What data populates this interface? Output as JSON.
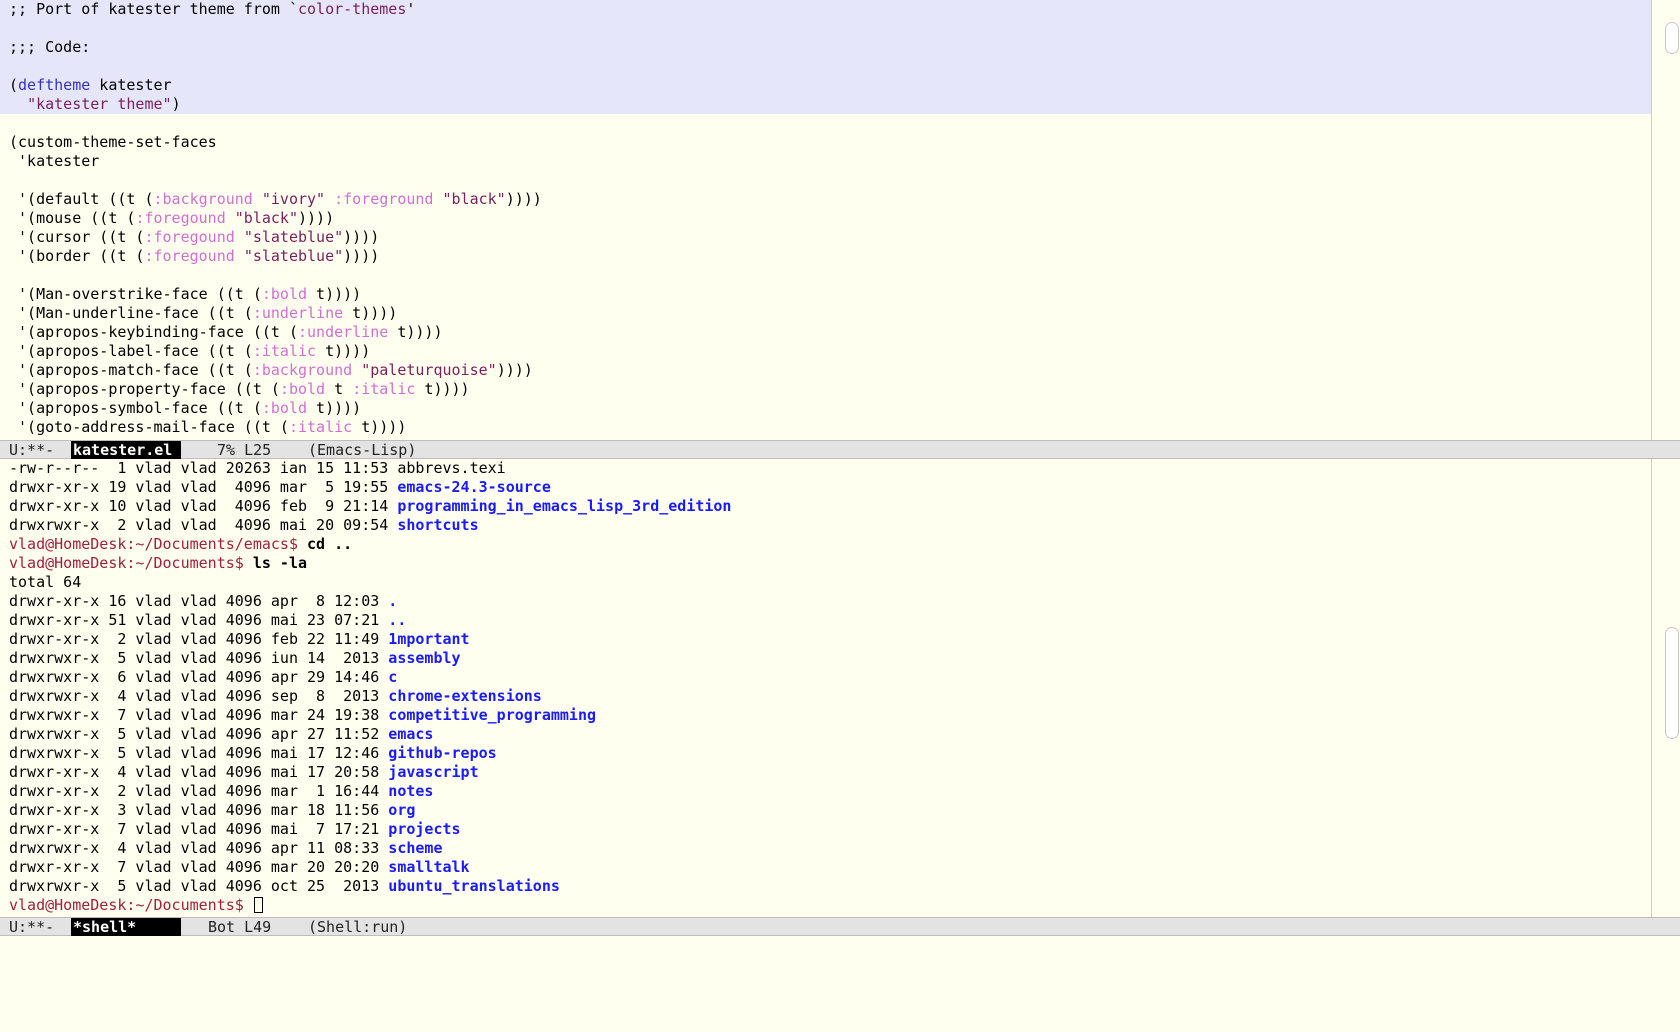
{
  "editor": {
    "lines": [
      {
        "hl": true,
        "segs": [
          {
            "t": ";; Port of katester theme from `"
          },
          {
            "t": "color-themes",
            "c": "str"
          },
          {
            "t": "'"
          }
        ]
      },
      {
        "hl": true,
        "segs": [
          {
            "t": ""
          }
        ]
      },
      {
        "hl": true,
        "segs": [
          {
            "t": ";;; Code:"
          }
        ]
      },
      {
        "hl": true,
        "segs": [
          {
            "t": ""
          }
        ]
      },
      {
        "hl": true,
        "segs": [
          {
            "t": "("
          },
          {
            "t": "deftheme",
            "c": "kw"
          },
          {
            "t": " katester"
          }
        ]
      },
      {
        "hl": true,
        "segs": [
          {
            "t": "  "
          },
          {
            "t": "\"katester theme\"",
            "c": "str"
          },
          {
            "t": ")"
          }
        ]
      },
      {
        "segs": [
          {
            "t": ""
          }
        ]
      },
      {
        "segs": [
          {
            "t": "(custom-theme-set-faces"
          }
        ]
      },
      {
        "segs": [
          {
            "t": " 'katester"
          }
        ]
      },
      {
        "segs": [
          {
            "t": ""
          }
        ]
      },
      {
        "segs": [
          {
            "t": " '(default ((t ("
          },
          {
            "t": ":background",
            "c": "key"
          },
          {
            "t": " "
          },
          {
            "t": "\"ivory\"",
            "c": "str"
          },
          {
            "t": " "
          },
          {
            "t": ":foreground",
            "c": "key"
          },
          {
            "t": " "
          },
          {
            "t": "\"black\"",
            "c": "str"
          },
          {
            "t": "))))"
          }
        ]
      },
      {
        "segs": [
          {
            "t": " '(mouse ((t ("
          },
          {
            "t": ":foregound",
            "c": "key"
          },
          {
            "t": " "
          },
          {
            "t": "\"black\"",
            "c": "str"
          },
          {
            "t": "))))"
          }
        ]
      },
      {
        "segs": [
          {
            "t": " '(cursor ((t ("
          },
          {
            "t": ":foregound",
            "c": "key"
          },
          {
            "t": " "
          },
          {
            "t": "\"slateblue\"",
            "c": "str"
          },
          {
            "t": "))))"
          }
        ]
      },
      {
        "segs": [
          {
            "t": " '(border ((t ("
          },
          {
            "t": ":foregound",
            "c": "key"
          },
          {
            "t": " "
          },
          {
            "t": "\"slateblue\"",
            "c": "str"
          },
          {
            "t": "))))"
          }
        ]
      },
      {
        "segs": [
          {
            "t": ""
          }
        ]
      },
      {
        "segs": [
          {
            "t": " '(Man-overstrike-face ((t ("
          },
          {
            "t": ":bold",
            "c": "key"
          },
          {
            "t": " t))))"
          }
        ]
      },
      {
        "segs": [
          {
            "t": " '(Man-underline-face ((t ("
          },
          {
            "t": ":underline",
            "c": "key"
          },
          {
            "t": " t))))"
          }
        ]
      },
      {
        "segs": [
          {
            "t": " '(apropos-keybinding-face ((t ("
          },
          {
            "t": ":underline",
            "c": "key"
          },
          {
            "t": " t))))"
          }
        ]
      },
      {
        "segs": [
          {
            "t": " '(apropos-label-face ((t ("
          },
          {
            "t": ":italic",
            "c": "key"
          },
          {
            "t": " t))))"
          }
        ]
      },
      {
        "segs": [
          {
            "t": " '(apropos-match-face ((t ("
          },
          {
            "t": ":background",
            "c": "key"
          },
          {
            "t": " "
          },
          {
            "t": "\"paleturquoise\"",
            "c": "str"
          },
          {
            "t": "))))"
          }
        ]
      },
      {
        "segs": [
          {
            "t": " '(apropos-property-face ((t ("
          },
          {
            "t": ":bold",
            "c": "key"
          },
          {
            "t": " t "
          },
          {
            "t": ":italic",
            "c": "key"
          },
          {
            "t": " t))))"
          }
        ]
      },
      {
        "segs": [
          {
            "t": " '(apropos-symbol-face ((t ("
          },
          {
            "t": ":bold",
            "c": "key"
          },
          {
            "t": " t))))"
          }
        ]
      },
      {
        "segs": [
          {
            "t": " '(goto-address-mail-face ((t ("
          },
          {
            "t": ":italic",
            "c": "key"
          },
          {
            "t": " t))))"
          }
        ]
      }
    ]
  },
  "modeline_top": {
    "state": "U:**-",
    "buffer": "katester.el",
    "position": "7% L25",
    "mode": "(Emacs-Lisp)"
  },
  "shell": {
    "lines": [
      {
        "segs": [
          {
            "t": "-rw-r--r--  1 vlad vlad 20263 ian 15 11:53 abbrevs.texi"
          }
        ]
      },
      {
        "segs": [
          {
            "t": "drwxr-xr-x 19 vlad vlad  4096 mar  5 19:55 "
          },
          {
            "t": "emacs-24.3-source",
            "c": "dir"
          }
        ]
      },
      {
        "segs": [
          {
            "t": "drwxr-xr-x 10 vlad vlad  4096 feb  9 21:14 "
          },
          {
            "t": "programming_in_emacs_lisp_3rd_edition",
            "c": "dir"
          }
        ]
      },
      {
        "segs": [
          {
            "t": "drwxrwxr-x  2 vlad vlad  4096 mai 20 09:54 "
          },
          {
            "t": "shortcuts",
            "c": "dir"
          }
        ]
      },
      {
        "segs": [
          {
            "t": "vlad@HomeDesk:~/Documents/emacs$ ",
            "c": "prompt"
          },
          {
            "t": "cd ..",
            "c": "cmd"
          }
        ]
      },
      {
        "segs": [
          {
            "t": "vlad@HomeDesk:~/Documents$ ",
            "c": "prompt"
          },
          {
            "t": "ls -la",
            "c": "cmd"
          }
        ]
      },
      {
        "segs": [
          {
            "t": "total 64"
          }
        ]
      },
      {
        "segs": [
          {
            "t": "drwxr-xr-x 16 vlad vlad 4096 apr  8 12:03 "
          },
          {
            "t": ".",
            "c": "dir"
          }
        ]
      },
      {
        "segs": [
          {
            "t": "drwxr-xr-x 51 vlad vlad 4096 mai 23 07:21 "
          },
          {
            "t": "..",
            "c": "dir"
          }
        ]
      },
      {
        "segs": [
          {
            "t": "drwxr-xr-x  2 vlad vlad 4096 feb 22 11:49 "
          },
          {
            "t": "1mportant",
            "c": "dir"
          }
        ]
      },
      {
        "segs": [
          {
            "t": "drwxrwxr-x  5 vlad vlad 4096 iun 14  2013 "
          },
          {
            "t": "assembly",
            "c": "dir"
          }
        ]
      },
      {
        "segs": [
          {
            "t": "drwxrwxr-x  6 vlad vlad 4096 apr 29 14:46 "
          },
          {
            "t": "c",
            "c": "dir"
          }
        ]
      },
      {
        "segs": [
          {
            "t": "drwxrwxr-x  4 vlad vlad 4096 sep  8  2013 "
          },
          {
            "t": "chrome-extensions",
            "c": "dir"
          }
        ]
      },
      {
        "segs": [
          {
            "t": "drwxrwxr-x  7 vlad vlad 4096 mar 24 19:38 "
          },
          {
            "t": "competitive_programming",
            "c": "dir"
          }
        ]
      },
      {
        "segs": [
          {
            "t": "drwxrwxr-x  5 vlad vlad 4096 apr 27 11:52 "
          },
          {
            "t": "emacs",
            "c": "dir"
          }
        ]
      },
      {
        "segs": [
          {
            "t": "drwxrwxr-x  5 vlad vlad 4096 mai 17 12:46 "
          },
          {
            "t": "github-repos",
            "c": "dir"
          }
        ]
      },
      {
        "segs": [
          {
            "t": "drwxr-xr-x  4 vlad vlad 4096 mai 17 20:58 "
          },
          {
            "t": "javascript",
            "c": "dir"
          }
        ]
      },
      {
        "segs": [
          {
            "t": "drwxr-xr-x  2 vlad vlad 4096 mar  1 16:44 "
          },
          {
            "t": "notes",
            "c": "dir"
          }
        ]
      },
      {
        "segs": [
          {
            "t": "drwxr-xr-x  3 vlad vlad 4096 mar 18 11:56 "
          },
          {
            "t": "org",
            "c": "dir"
          }
        ]
      },
      {
        "segs": [
          {
            "t": "drwxr-xr-x  7 vlad vlad 4096 mai  7 17:21 "
          },
          {
            "t": "projects",
            "c": "dir"
          }
        ]
      },
      {
        "segs": [
          {
            "t": "drwxrwxr-x  4 vlad vlad 4096 apr 11 08:33 "
          },
          {
            "t": "scheme",
            "c": "dir"
          }
        ]
      },
      {
        "segs": [
          {
            "t": "drwxr-xr-x  7 vlad vlad 4096 mar 20 20:20 "
          },
          {
            "t": "smalltalk",
            "c": "dir"
          }
        ]
      },
      {
        "segs": [
          {
            "t": "drwxrwxr-x  5 vlad vlad 4096 oct 25  2013 "
          },
          {
            "t": "ubuntu_translations",
            "c": "dir"
          }
        ]
      },
      {
        "segs": [
          {
            "t": "vlad@HomeDesk:~/Documents$ ",
            "c": "prompt"
          }
        ],
        "cursor": true
      }
    ]
  },
  "modeline_bottom": {
    "state": "U:**-",
    "buffer": "*shell*",
    "position": "Bot L49",
    "mode": "(Shell:run)"
  },
  "colors": {
    "background": "#fffff0",
    "region_highlight": "#e6e6fa",
    "keyword": "#3232c8",
    "string": "#7a1f5c",
    "constant": "#d070d0",
    "directory": "#1a1aff",
    "prompt": "#a0203c"
  },
  "scrollbar": {
    "top_visible_fraction": 0.07,
    "bottom_at_end": true
  }
}
